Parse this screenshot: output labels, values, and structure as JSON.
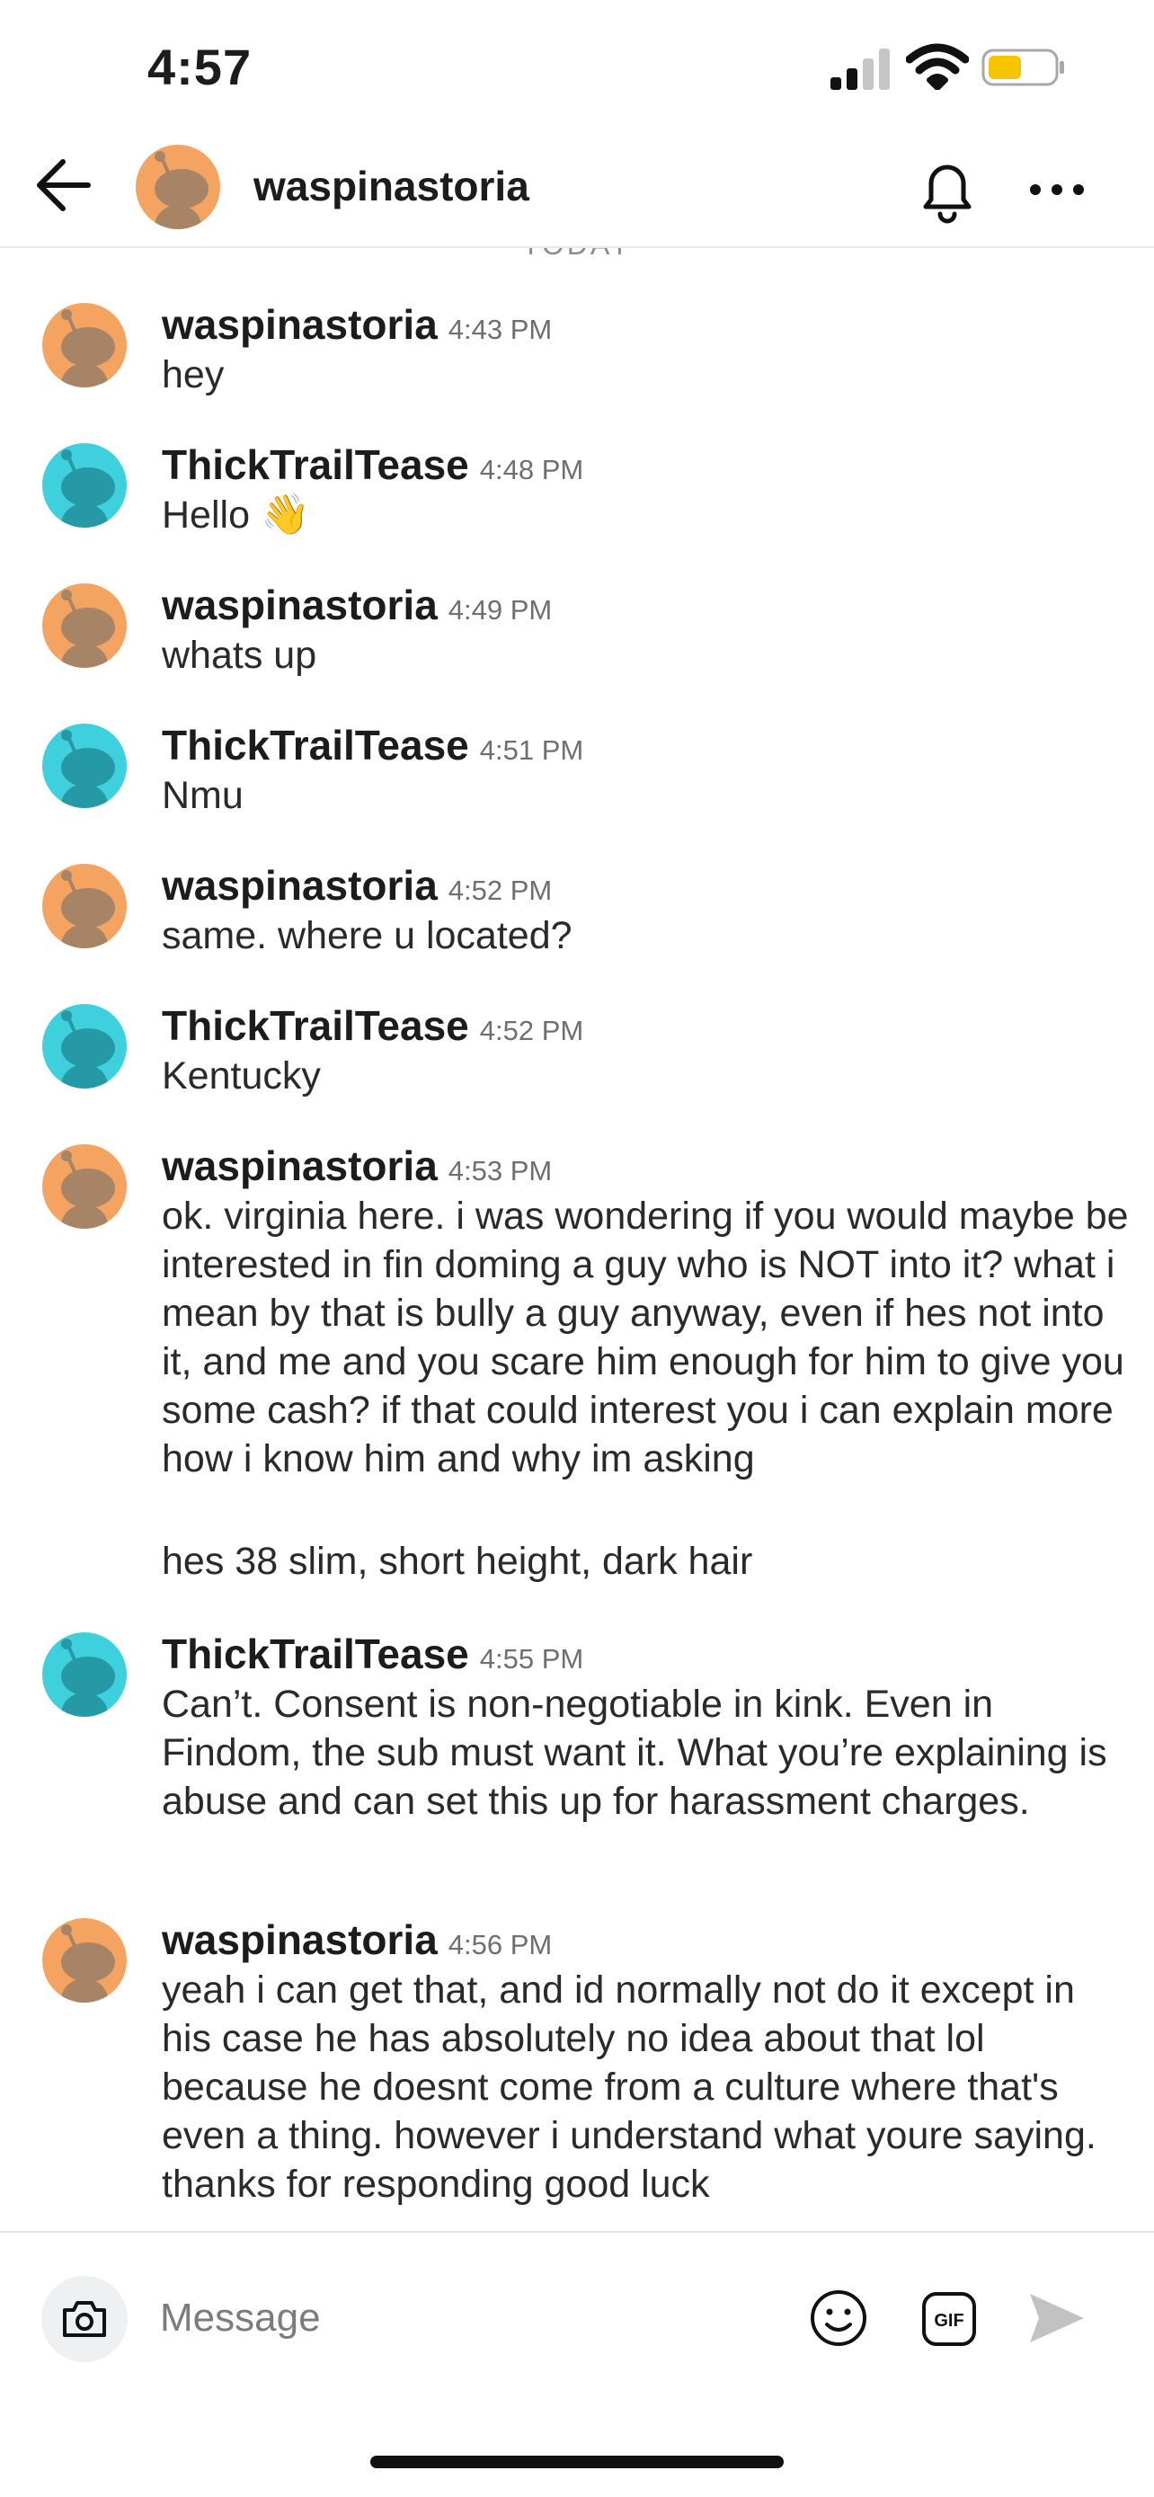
{
  "status_bar": {
    "time": "4:57",
    "signal_icon": "cellular-signal-icon",
    "wifi_icon": "wifi-icon",
    "battery_icon": "battery-icon",
    "battery_color": "#f5c600"
  },
  "header": {
    "back_icon": "back-arrow-icon",
    "avatar_icon": "snoo-avatar-orange",
    "name": "waspinastoria",
    "bell_icon": "bell-icon",
    "more_icon": "more-horizontal-icon"
  },
  "today_label": "TODAY",
  "colors": {
    "orange_avatar": "#f4a460",
    "cyan_avatar": "#3fd0dd",
    "accent_text": "#1c1c1c"
  },
  "messages": [
    {
      "author": "waspinastoria",
      "time": "4:43 PM",
      "text": "hey",
      "avatar": "orange"
    },
    {
      "author": "ThickTrailTease",
      "time": "4:48 PM",
      "text": "Hello",
      "emoji": "👋",
      "avatar": "cyan"
    },
    {
      "author": "waspinastoria",
      "time": "4:49 PM",
      "text": "whats up",
      "avatar": "orange"
    },
    {
      "author": "ThickTrailTease",
      "time": "4:51 PM",
      "text": "Nmu",
      "avatar": "cyan"
    },
    {
      "author": "waspinastoria",
      "time": "4:52 PM",
      "text": "same. where u located?",
      "avatar": "orange"
    },
    {
      "author": "ThickTrailTease",
      "time": "4:52 PM",
      "text": "Kentucky",
      "avatar": "cyan"
    },
    {
      "author": "waspinastoria",
      "time": "4:53 PM",
      "text": "ok. virginia here. i was wondering if you would maybe be interested in fin doming a guy who is NOT into it? what i mean by that is bully a guy anyway, even if hes not into it, and me and you scare him enough for him to give you some cash? if that could interest you i can explain more how i know him and why im asking",
      "text2": "hes 38 slim, short height, dark hair",
      "avatar": "orange"
    },
    {
      "author": "ThickTrailTease",
      "time": "4:55 PM",
      "text": "Can’t. Consent is non-negotiable in kink. Even in Findom, the sub must want it. What you’re explaining is abuse and can set this up for harassment charges.",
      "avatar": "cyan"
    },
    {
      "author": "waspinastoria",
      "time": "4:56 PM",
      "text": "yeah i can get that, and id normally not do it except in his case he has absolutely no idea about that lol because he doesnt come from a culture where that's even a thing. however i understand what youre saying. thanks for responding good luck",
      "avatar": "orange"
    }
  ],
  "composer": {
    "camera_icon": "camera-icon",
    "placeholder": "Message",
    "emoji_icon": "smiley-icon",
    "gif_label": "GIF",
    "send_icon": "send-icon"
  }
}
